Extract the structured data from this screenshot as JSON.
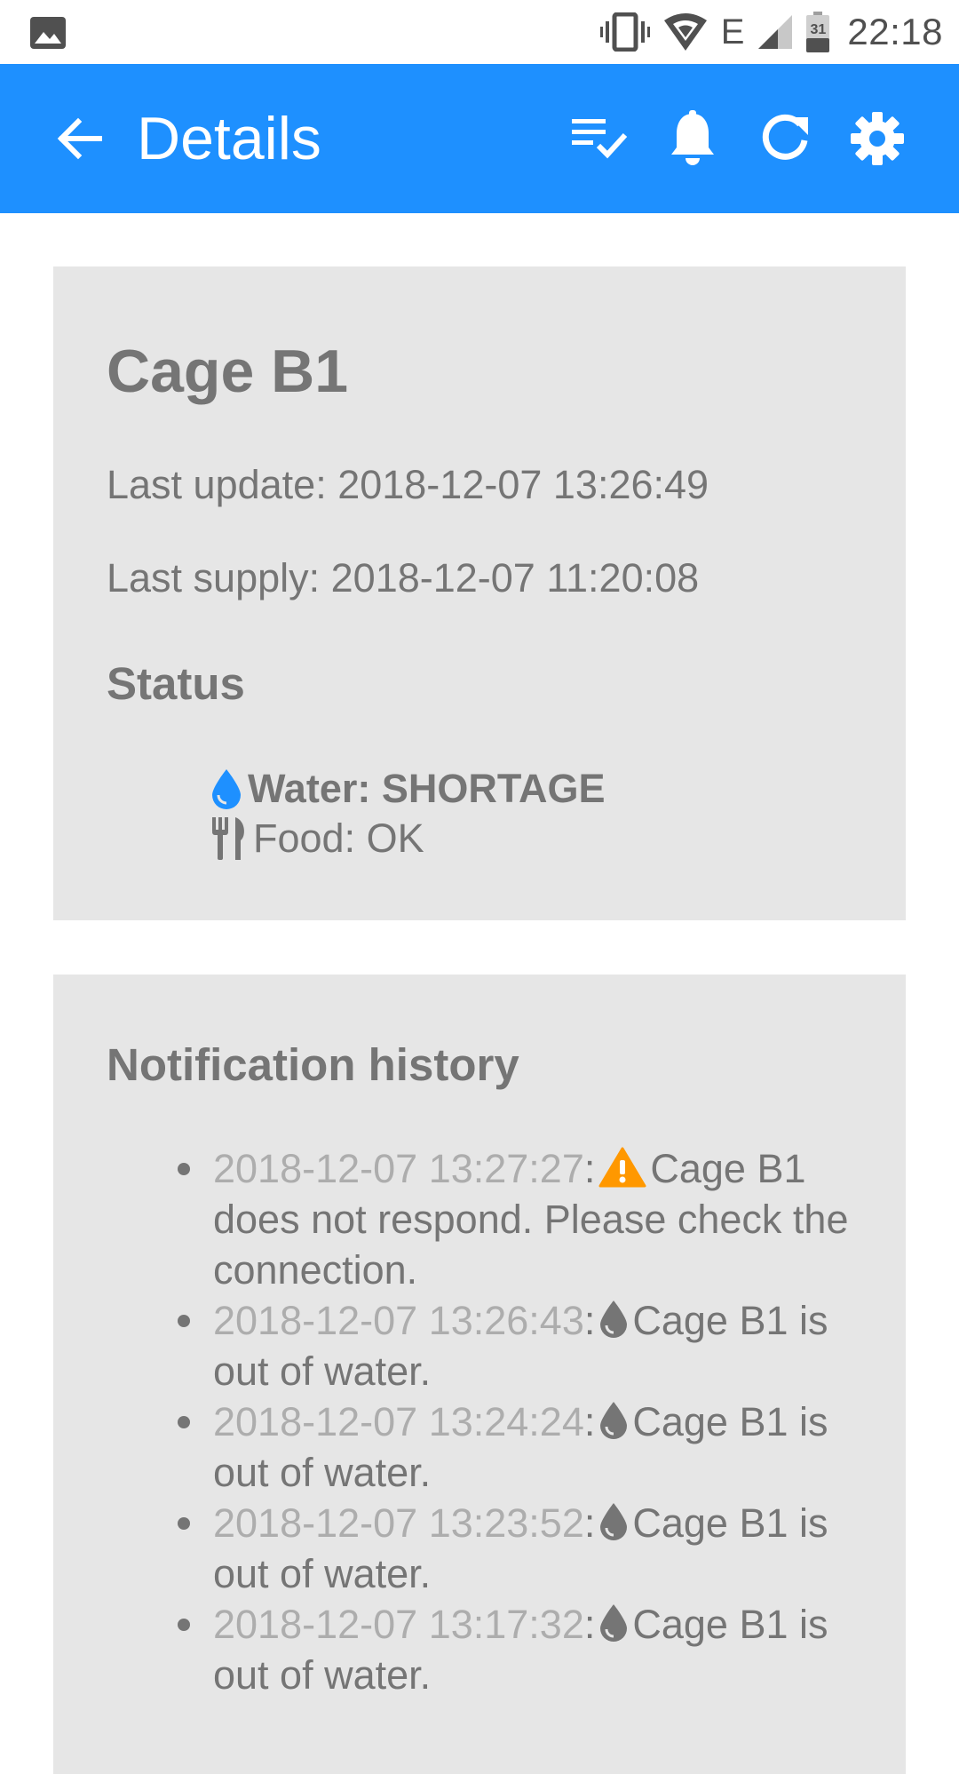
{
  "status_bar": {
    "time": "22:18",
    "battery_level": "31",
    "network_type": "E",
    "icons": [
      "gallery-icon",
      "vibrate-icon",
      "wifi-icon",
      "network-type-icon",
      "signal-icon",
      "battery-icon"
    ]
  },
  "app_bar": {
    "title": "Details",
    "background_color": "#1e90ff",
    "icons": [
      "back-arrow-icon",
      "checklist-icon",
      "bell-icon",
      "refresh-icon",
      "gear-icon"
    ]
  },
  "details": {
    "cage_name": "Cage B1",
    "last_update": "Last update: 2018-12-07 13:26:49",
    "last_supply": "Last supply: 2018-12-07 11:20:08",
    "status_title": "Status",
    "water_status": "Water: SHORTAGE",
    "food_status": "Food: OK",
    "water_icon_color": "#1e90ff"
  },
  "notifications": {
    "title": "Notification history",
    "warning_icon_color": "#ff9800",
    "items": [
      {
        "time": "2018-12-07 13:27:27",
        "icon": "warning-icon",
        "message": "Cage B1 does not respond. Please check the connection."
      },
      {
        "time": "2018-12-07 13:26:43",
        "icon": "water-drop-icon",
        "message": "Cage B1 is out of water."
      },
      {
        "time": "2018-12-07 13:24:24",
        "icon": "water-drop-icon",
        "message": "Cage B1 is out of water."
      },
      {
        "time": "2018-12-07 13:23:52",
        "icon": "water-drop-icon",
        "message": "Cage B1 is out of water."
      },
      {
        "time": "2018-12-07 13:17:32",
        "icon": "water-drop-icon",
        "message": "Cage B1 is out of water."
      }
    ]
  }
}
